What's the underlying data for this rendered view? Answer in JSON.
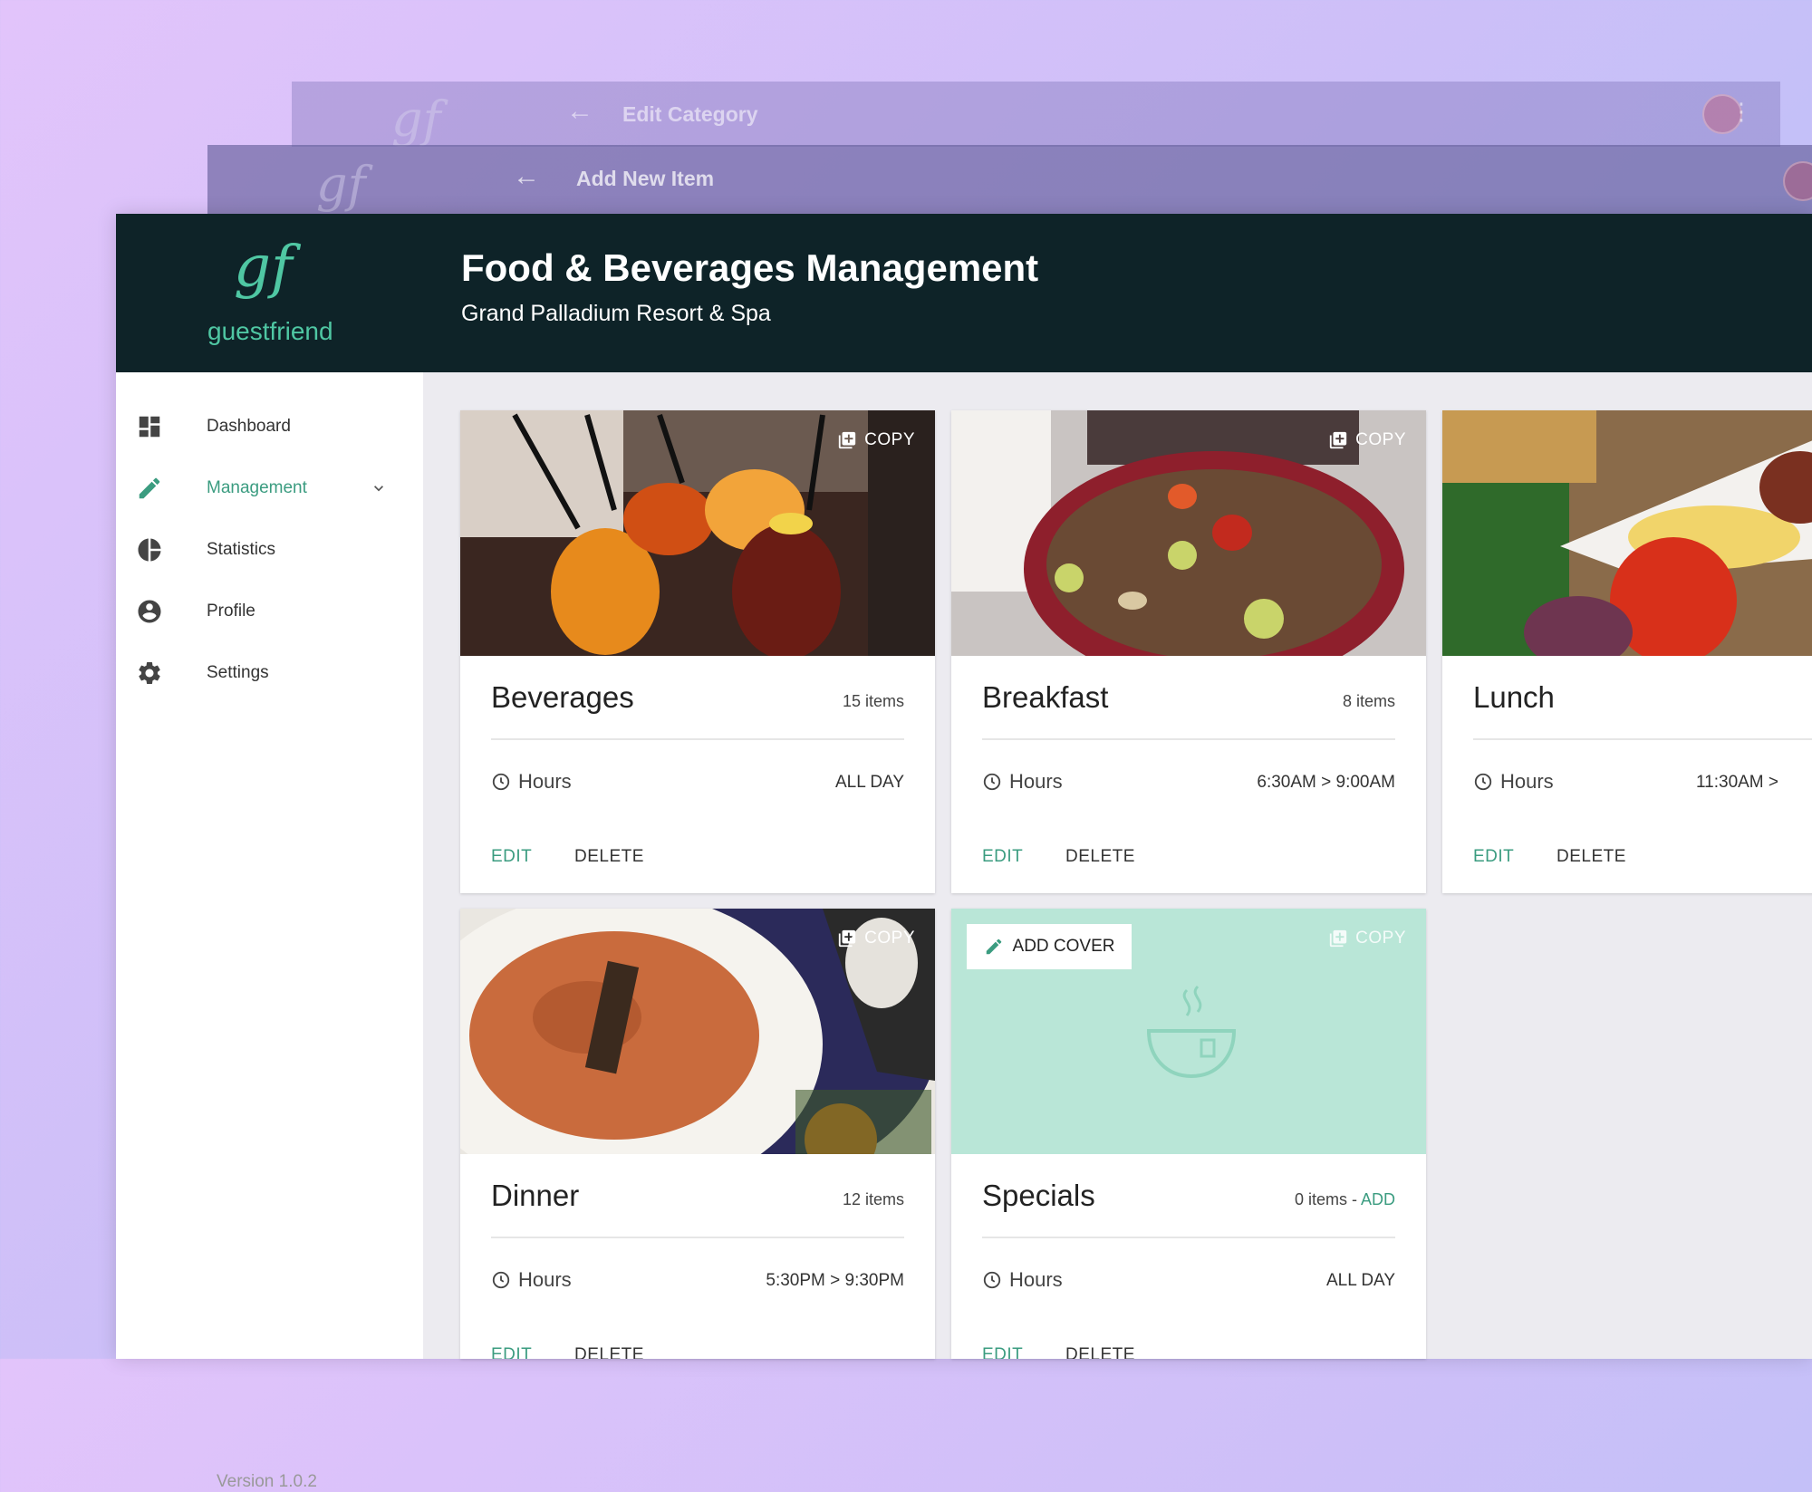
{
  "background_windows": [
    {
      "title": "Edit Category"
    },
    {
      "title": "Add New Item"
    }
  ],
  "header": {
    "logo_mark": "gf",
    "logo_text": "guestfriend",
    "title": "Food & Beverages Management",
    "subtitle": "Grand Palladium Resort & Spa"
  },
  "sidebar": {
    "items": [
      {
        "label": "Dashboard",
        "icon": "dashboard-icon"
      },
      {
        "label": "Management",
        "icon": "pencil-icon",
        "active": true
      },
      {
        "label": "Statistics",
        "icon": "pie-chart-icon"
      },
      {
        "label": "Profile",
        "icon": "account-circle-icon"
      },
      {
        "label": "Settings",
        "icon": "gear-icon"
      }
    ],
    "version": "Version 1.0.2"
  },
  "cards": [
    {
      "name": "Beverages",
      "count": "15 items",
      "hours_label": "Hours",
      "hours": "ALL DAY",
      "copy_label": "COPY",
      "edit_label": "EDIT",
      "delete_label": "DELETE"
    },
    {
      "name": "Breakfast",
      "count": "8 items",
      "hours_label": "Hours",
      "hours": "6:30AM  >  9:00AM",
      "copy_label": "COPY",
      "edit_label": "EDIT",
      "delete_label": "DELETE"
    },
    {
      "name": "Lunch",
      "count": "",
      "hours_label": "Hours",
      "hours": "11:30AM  >",
      "copy_label": "",
      "edit_label": "EDIT",
      "delete_label": "DELETE"
    },
    {
      "name": "Dinner",
      "count": "12 items",
      "hours_label": "Hours",
      "hours": "5:30PM  >  9:30PM",
      "copy_label": "COPY",
      "edit_label": "EDIT",
      "delete_label": "DELETE"
    },
    {
      "name": "Specials",
      "count": "0 items - ",
      "add_label": "ADD",
      "hours_label": "Hours",
      "hours": "ALL DAY",
      "copy_label": "COPY",
      "add_cover_label": "ADD COVER",
      "edit_label": "EDIT",
      "delete_label": "DELETE"
    }
  ],
  "colors": {
    "accent": "#3b9c80",
    "header_bg": "#0e2328",
    "content_bg": "#ecebf0"
  }
}
